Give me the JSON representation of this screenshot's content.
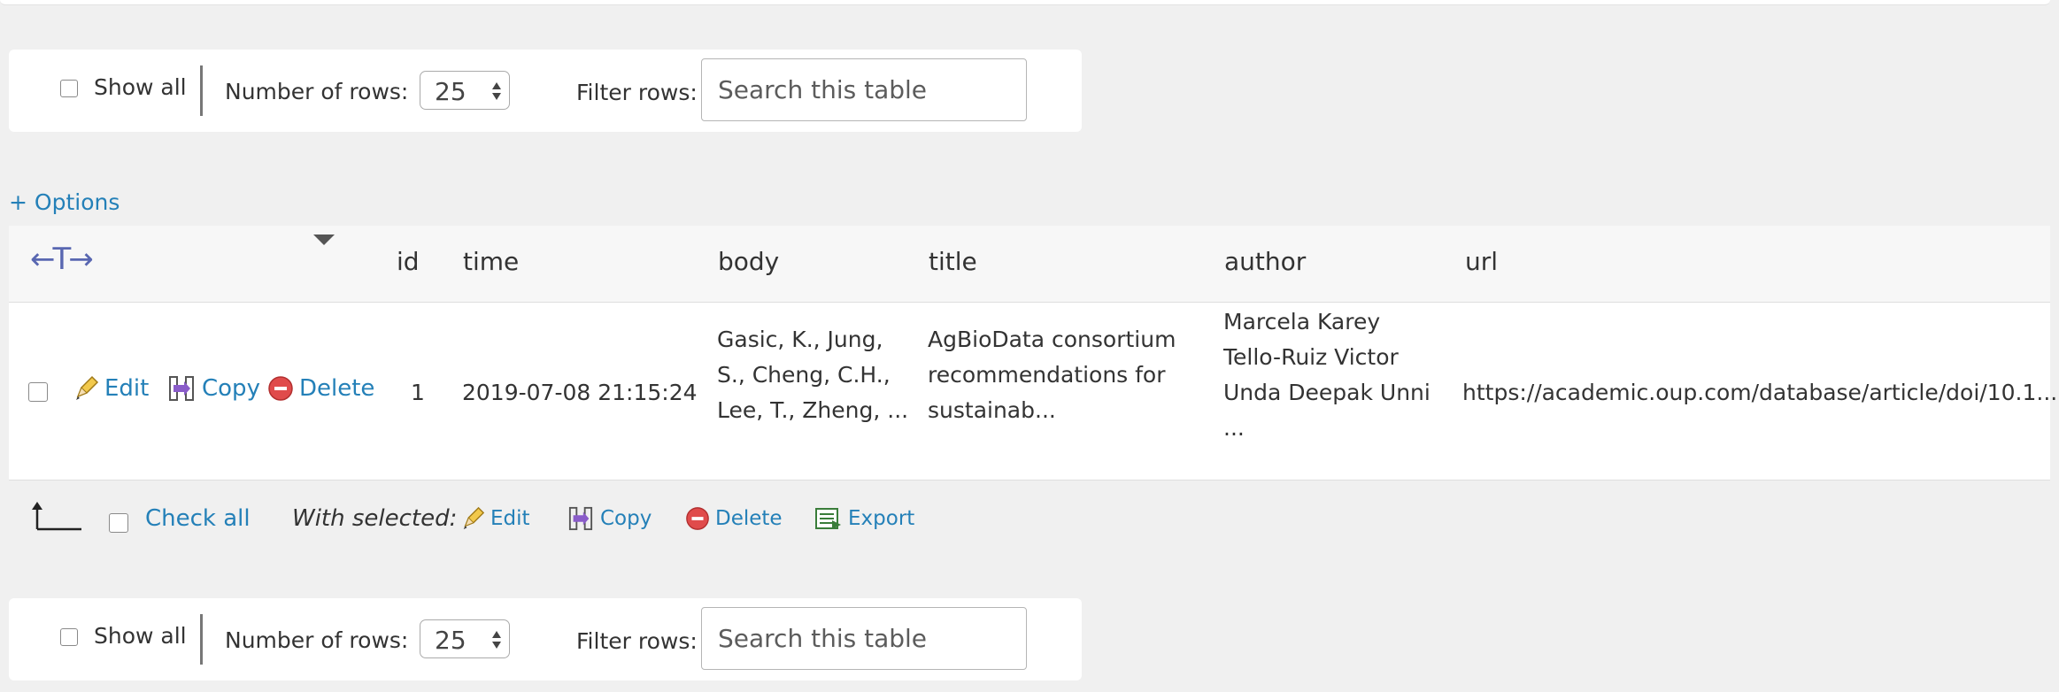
{
  "navigation": {
    "show_all_label": "Show all",
    "rows_label": "Number of rows:",
    "rows_value": "25",
    "filter_label": "Filter rows:",
    "search_placeholder": "Search this table"
  },
  "options_link": "+ Options",
  "table": {
    "columns": [
      "id",
      "time",
      "body",
      "title",
      "author",
      "url"
    ],
    "rows": [
      {
        "id": "1",
        "time": "2019-07-08 21:15:24",
        "body_lines": [
          "Gasic, K., Jung,",
          "S., Cheng, C.H.,",
          "Lee, T., Zheng, ..."
        ],
        "title_lines": [
          "AgBioData consortium",
          "recommendations for",
          "sustainab..."
        ],
        "author_lines": [
          "Marcela Karey",
          "Tello-Ruiz Victor",
          "Unda  Deepak Unni",
          "..."
        ],
        "url": "https://academic.oup.com/database/article/doi/10.1..."
      }
    ],
    "row_actions": {
      "edit": "Edit",
      "copy": "Copy",
      "delete": "Delete"
    }
  },
  "bulk_actions": {
    "check_all": "Check all",
    "with_selected": "With selected:",
    "edit": "Edit",
    "copy": "Copy",
    "delete": "Delete",
    "export": "Export"
  },
  "colors": {
    "link": "#2480b8",
    "background": "#f0f0f0",
    "delete_icon": "#e04b4b",
    "arrows_icon": "#5967b1"
  }
}
